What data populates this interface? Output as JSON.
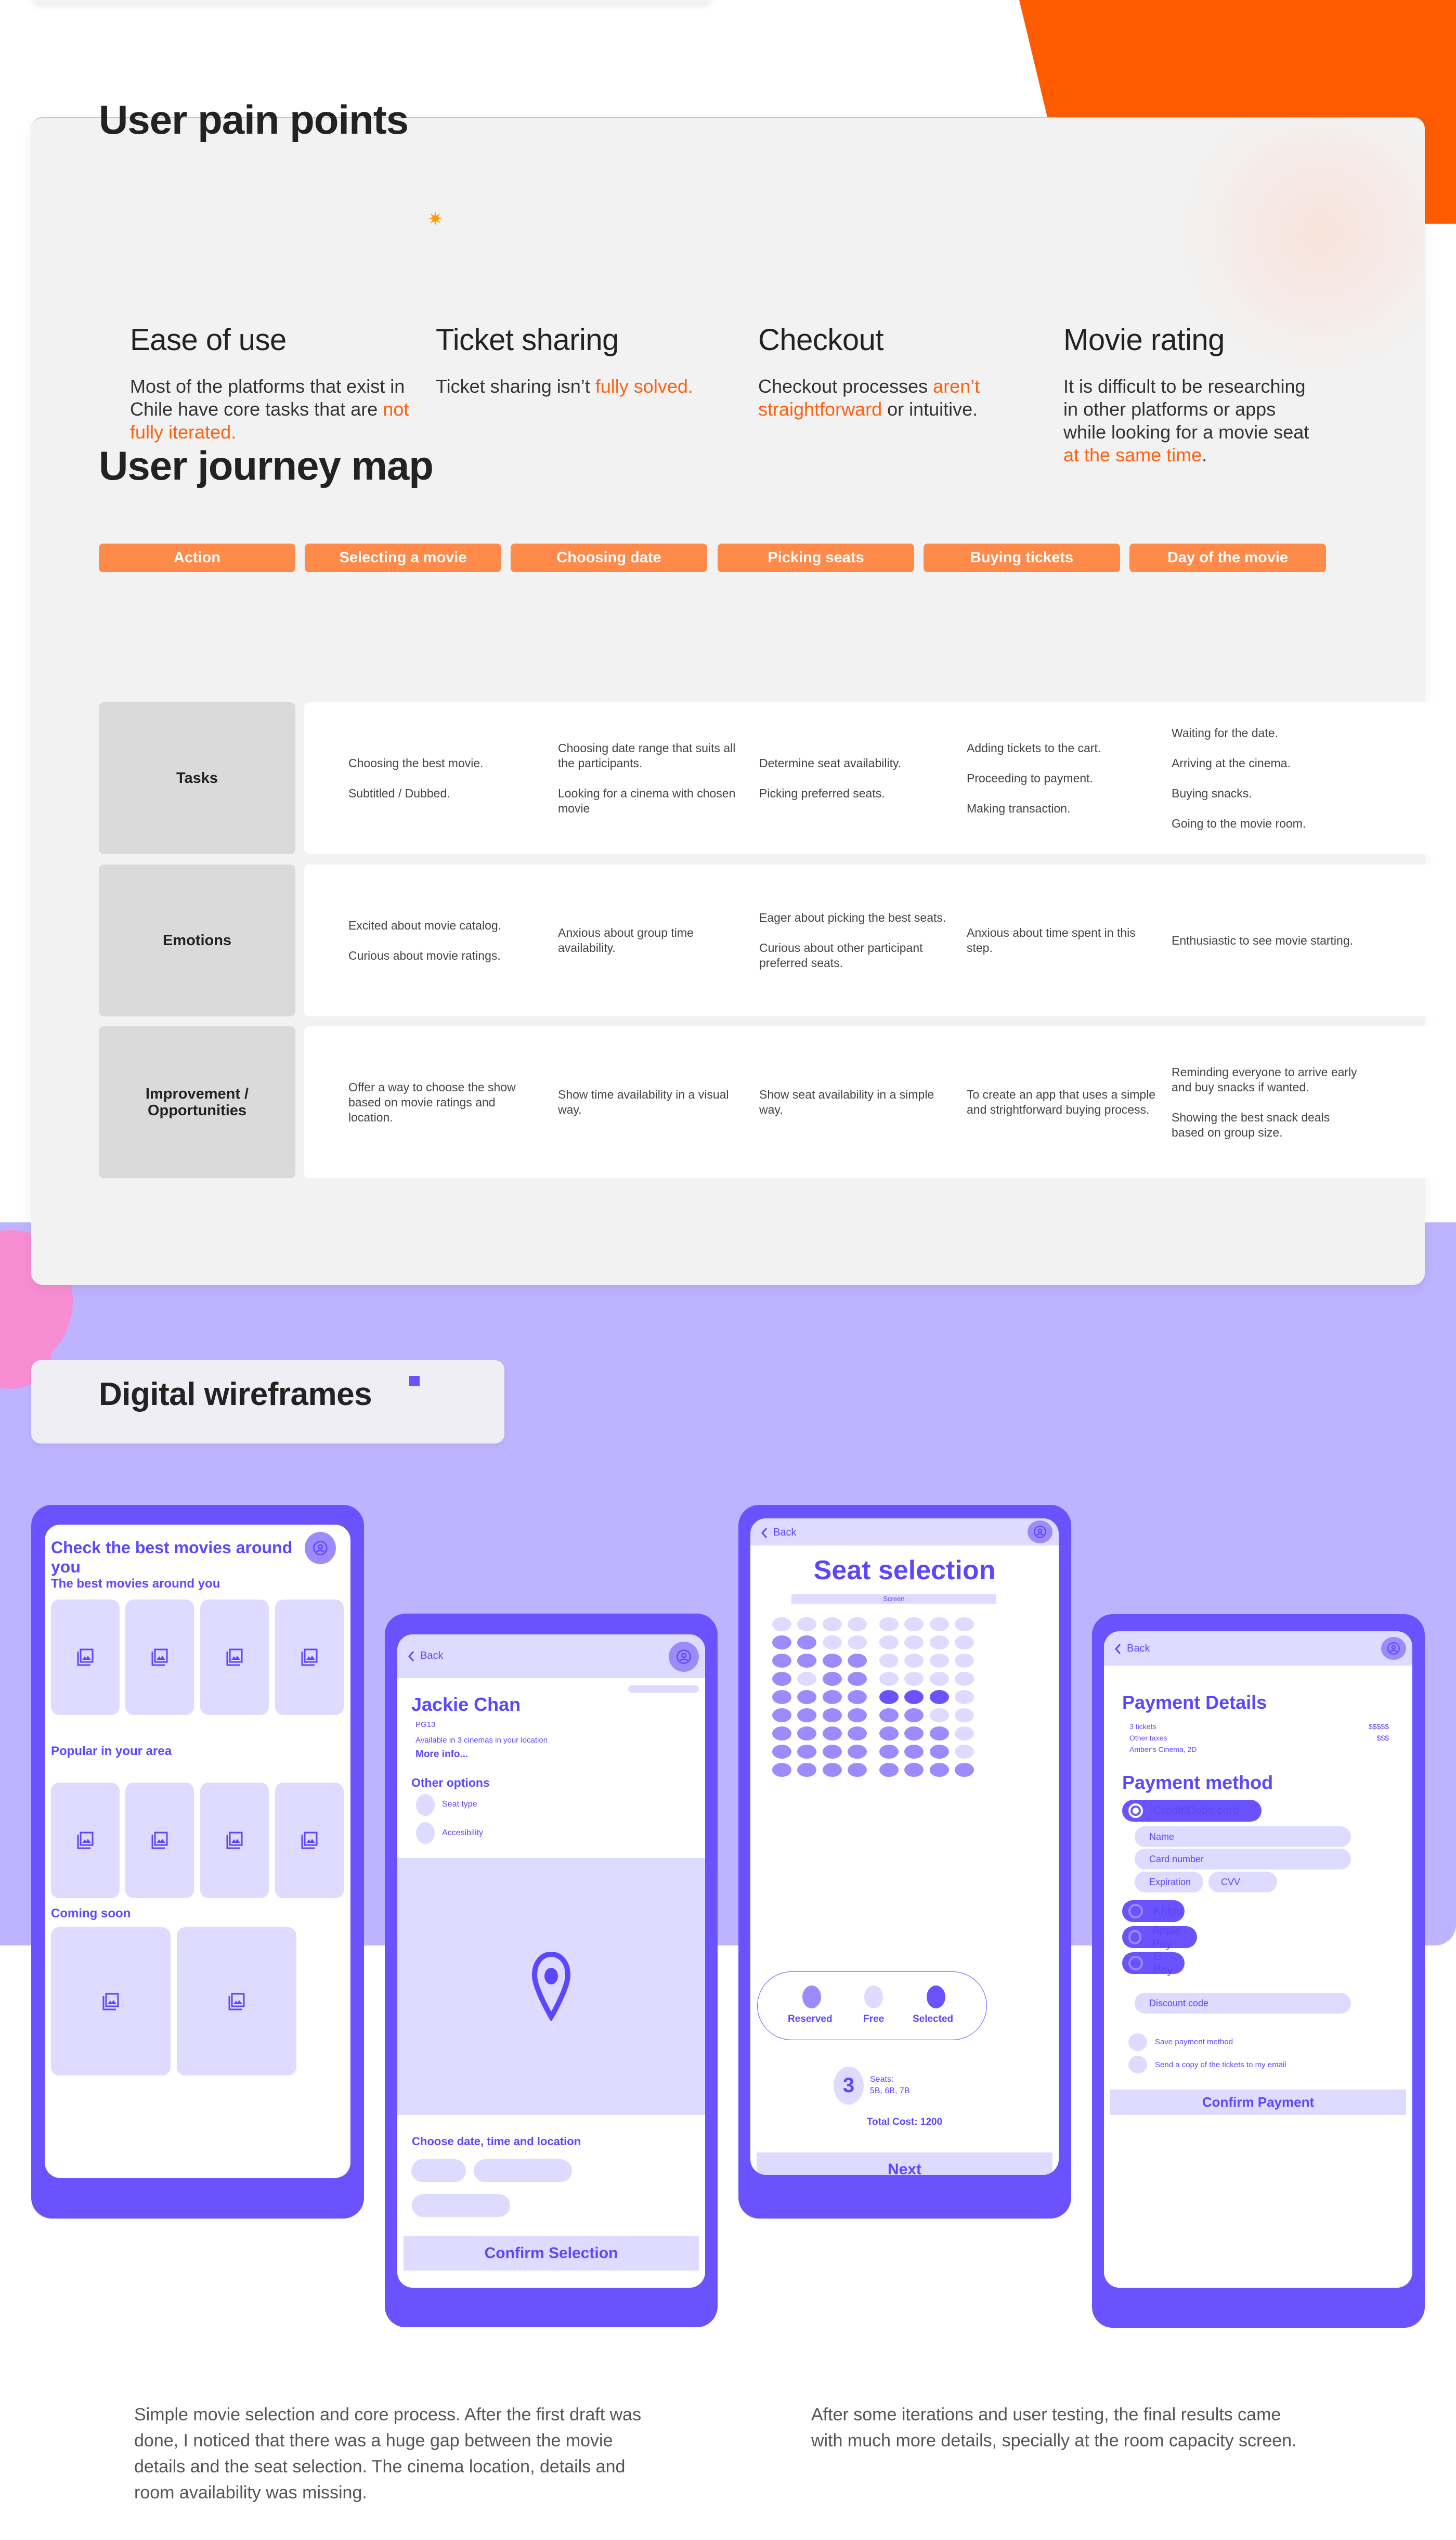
{
  "colors": {
    "accent_orange": "#ff5b00",
    "journey_header": "#ff8a4a",
    "highlight": "#ff6010",
    "wire_purple": "#6a52ff",
    "wire_light": "#dfdaff",
    "wire_mid": "#9b8bfd",
    "band_purple": "#bdb3fe"
  },
  "pain_points": {
    "title": "User pain points",
    "items": [
      {
        "heading": "Ease of use",
        "text_before": "Most of the platforms that exist in Chile have core tasks that are ",
        "highlight": "not fully iterated.",
        "text_after": ""
      },
      {
        "heading": "Ticket sharing",
        "text_before": "Ticket sharing isn’t ",
        "highlight": "fully solved.",
        "text_after": ""
      },
      {
        "heading": "Checkout",
        "text_before": "Checkout processes ",
        "highlight": "aren’t straightforward",
        "text_after": " or intuitive."
      },
      {
        "heading": "Movie rating",
        "text_before": "It is difficult to be researching in other platforms or apps while looking for a movie seat ",
        "highlight": "at the same time",
        "text_after": "."
      }
    ]
  },
  "journey": {
    "title": "User journey map",
    "headers": [
      "Action",
      "Selecting a movie",
      "Choosing date",
      "Picking seats",
      "Buying tickets",
      "Day of the movie"
    ],
    "rows": [
      {
        "label": "Tasks",
        "cells": [
          [
            "Choosing the best movie.",
            "Subtitled / Dubbed."
          ],
          [
            "Choosing date range that suits all the participants.",
            "Looking for a cinema with chosen movie"
          ],
          [
            "Determine seat availability.",
            "Picking preferred seats."
          ],
          [
            "Adding tickets to the cart.",
            "Proceeding to payment.",
            "Making transaction."
          ],
          [
            "Waiting for the date.",
            "Arriving at the cinema.",
            "Buying snacks.",
            "Going to the movie room."
          ]
        ]
      },
      {
        "label": "Emotions",
        "cells": [
          [
            "Excited about movie catalog.",
            "Curious about movie ratings."
          ],
          [
            "Anxious about group time availability."
          ],
          [
            "Eager about picking the best seats.",
            "Curious about other participant preferred seats."
          ],
          [
            "Anxious about time spent in this step."
          ],
          [
            "Enthusiastic to see movie starting."
          ]
        ]
      },
      {
        "label": "Improvement / Opportunities",
        "cells": [
          [
            "Offer a way to choose the show based on movie ratings and location."
          ],
          [
            "Show time availability in a visual way."
          ],
          [
            "Show seat availability in a simple way."
          ],
          [
            "To create an app that uses a simple and strightforward buying process."
          ],
          [
            "Reminding everyone to arrive early and buy snacks if wanted.",
            "Showing the best snack deals based on group size."
          ]
        ]
      }
    ]
  },
  "wireframes": {
    "title": "Digital wireframes",
    "home": {
      "heading": "Check the best movies around you",
      "sub": "The best movies around you",
      "popular": "Popular in your area",
      "coming": "Coming soon"
    },
    "details": {
      "back": "Back",
      "movie": "Jackie Chan",
      "rating": "PG13",
      "availability": "Available in 3 cinemas in your location",
      "more": "More info...",
      "other_options": "Other options",
      "options": [
        "Seat type",
        "Accesibility"
      ],
      "choose": "Choose date, time and location",
      "confirm": "Confirm Selection"
    },
    "seats": {
      "back": "Back",
      "title": "Seat selection",
      "screen": "Screen",
      "grid": [
        [
          "f",
          "f",
          "f",
          "f",
          "f",
          "f",
          "f",
          "f"
        ],
        [
          "r",
          "r",
          "f",
          "f",
          "f",
          "f",
          "f",
          "f"
        ],
        [
          "r",
          "r",
          "r",
          "r",
          "f",
          "f",
          "f",
          "f"
        ],
        [
          "r",
          "f",
          "r",
          "r",
          "f",
          "f",
          "f",
          "f"
        ],
        [
          "r",
          "r",
          "r",
          "r",
          "s",
          "s",
          "s",
          "f"
        ],
        [
          "r",
          "r",
          "r",
          "r",
          "r",
          "r",
          "f",
          "f"
        ],
        [
          "r",
          "r",
          "r",
          "r",
          "r",
          "r",
          "r",
          "f"
        ],
        [
          "r",
          "r",
          "r",
          "r",
          "r",
          "r",
          "r",
          "f"
        ],
        [
          "r",
          "r",
          "r",
          "r",
          "r",
          "r",
          "r",
          "r"
        ]
      ],
      "legend": [
        "Reserved",
        "Free",
        "Selected"
      ],
      "count": "3",
      "seats_label": "Seats:",
      "seats_list": "5B, 6B, 7B",
      "total": "Total Cost: 1200",
      "next": "Next"
    },
    "payment": {
      "back": "Back",
      "details_title": "Payment Details",
      "lines": [
        {
          "label": "3 tickets",
          "value": "$$$$$"
        },
        {
          "label": "Other taxes",
          "value": "$$$"
        },
        {
          "label": "Amber’s Cinema, 2D",
          "value": ""
        }
      ],
      "method_title": "Payment method",
      "methods": [
        "Credit/Debit card",
        "Khipu",
        "Apple Pay",
        "G Pay"
      ],
      "selected_method": "Credit/Debit card",
      "fields": {
        "name": "Name",
        "card": "Card number",
        "exp": "Expiration",
        "cvv": "CVV"
      },
      "discount": "Discount code",
      "checks": [
        "Save payment method",
        "Send a copy of the tickets to my email"
      ],
      "confirm": "Confirm Payment"
    }
  },
  "captions": {
    "left": "Simple movie selection and core process. After the first draft was done, I noticed that there was a huge gap between the movie details and the seat selection. The cinema location, details and room availability was missing.",
    "right": "After some iterations and user testing, the final results came with much more details, specially at the room capacity screen."
  }
}
